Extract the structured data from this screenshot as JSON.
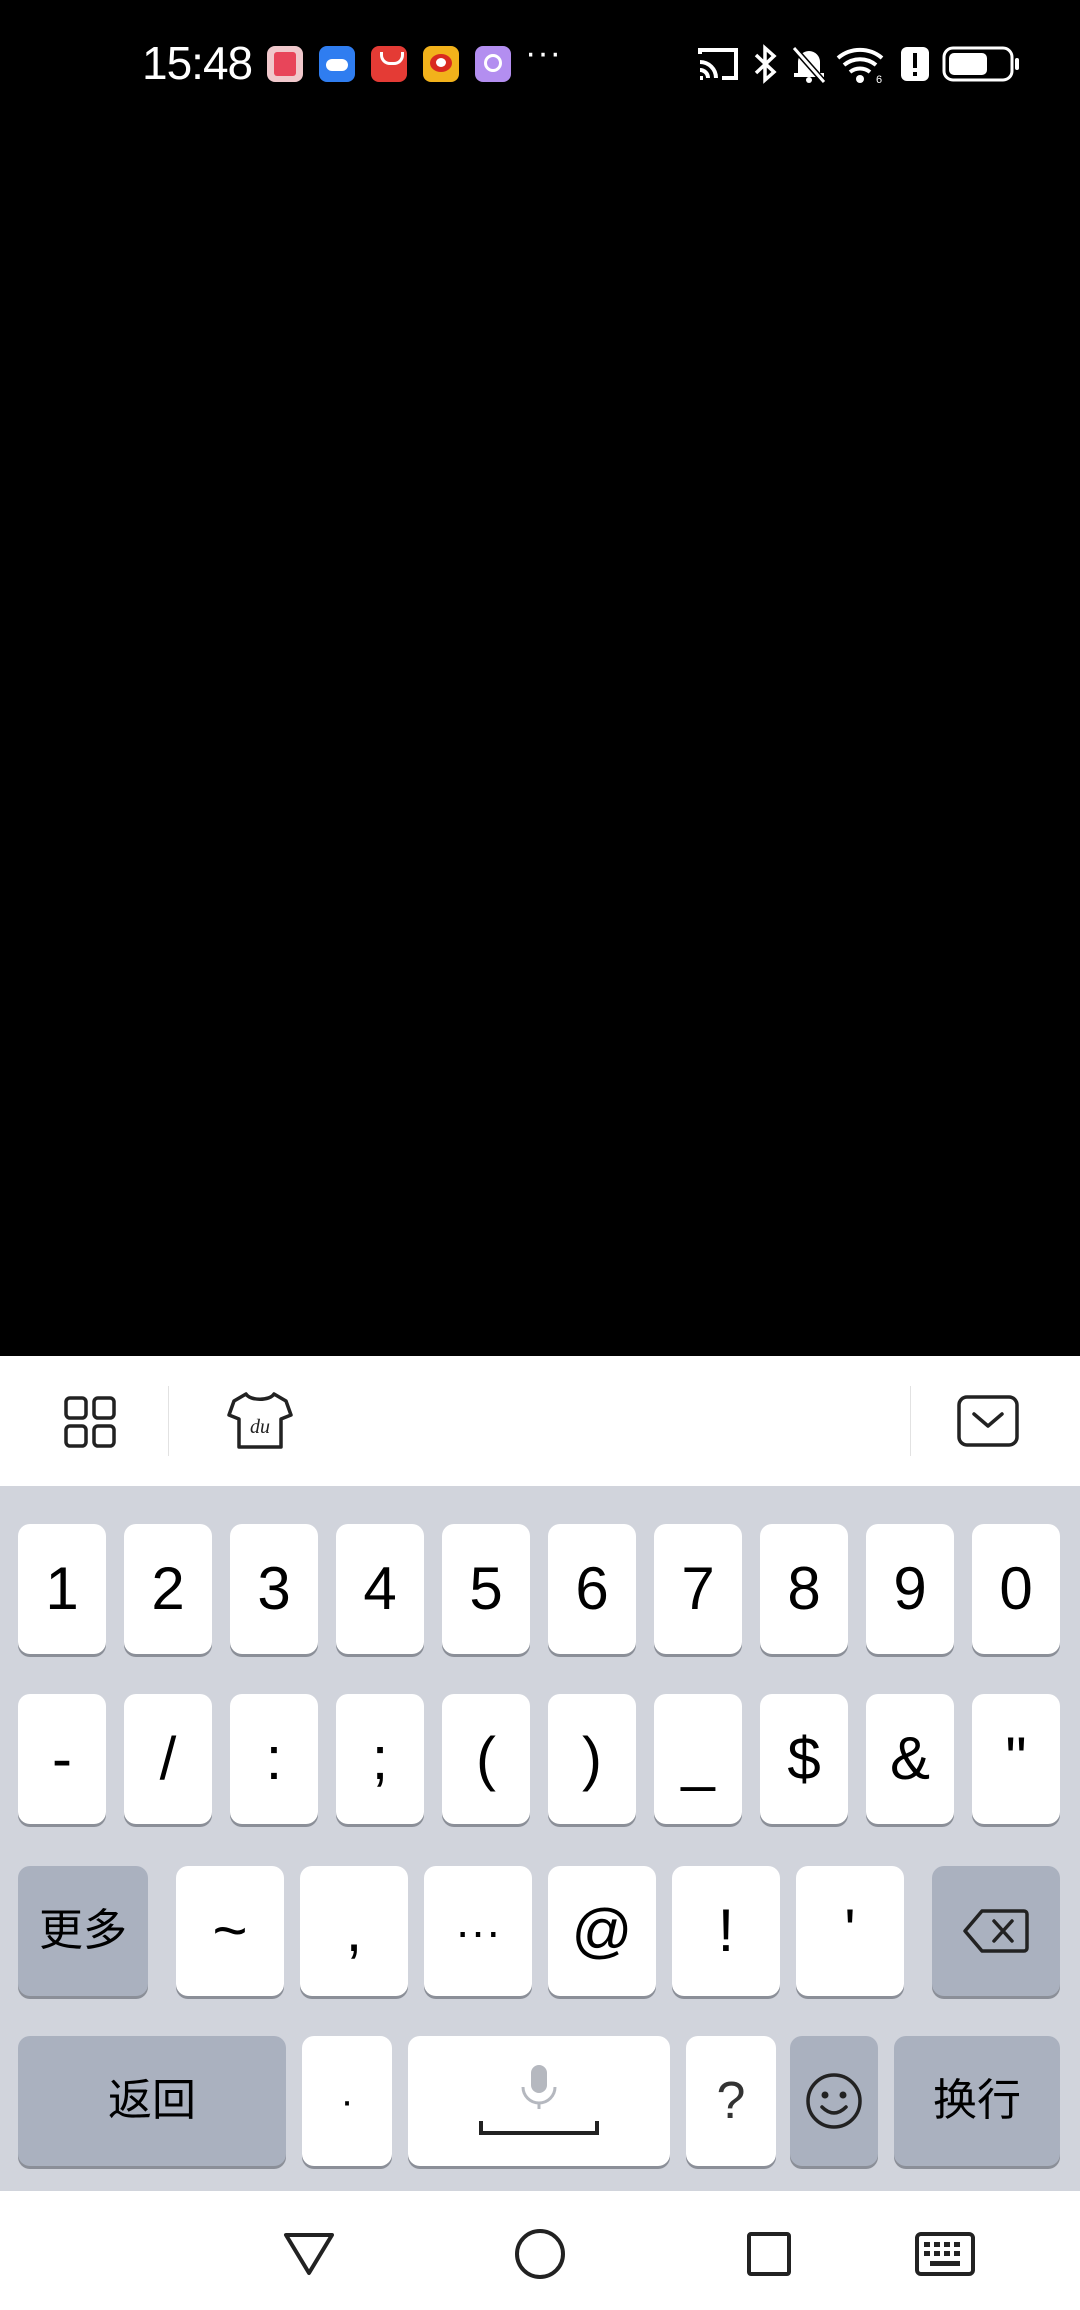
{
  "status_bar": {
    "time": "15:48",
    "more_indicator": "···",
    "notification_icons": [
      "red-book-app-icon",
      "cloud-app-icon",
      "red-envelope-app-icon",
      "weibo-app-icon",
      "purple-app-icon"
    ],
    "system_icons": [
      "cast-icon",
      "bluetooth-icon",
      "mute-bell-icon",
      "wifi-icon",
      "alert-icon",
      "battery-icon"
    ]
  },
  "toolbar": {
    "icons": [
      "apps-grid-icon",
      "skin-shirt-icon",
      "collapse-keyboard-icon"
    ]
  },
  "keyboard": {
    "row1": [
      "1",
      "2",
      "3",
      "4",
      "5",
      "6",
      "7",
      "8",
      "9",
      "0"
    ],
    "row2": [
      "-",
      "/",
      ":",
      ";",
      "(",
      ")",
      "_",
      "$",
      "&",
      "\""
    ],
    "row3": [
      "~",
      ",",
      "···",
      "@",
      "!",
      "'"
    ],
    "more_label": "更多",
    "back_label": "返回",
    "dot_label": "·",
    "question_label": "?",
    "enter_label": "换行"
  },
  "nav_bar": {
    "icons": [
      "back-triangle-icon",
      "home-circle-icon",
      "recents-square-icon",
      "keyboard-icon"
    ]
  }
}
